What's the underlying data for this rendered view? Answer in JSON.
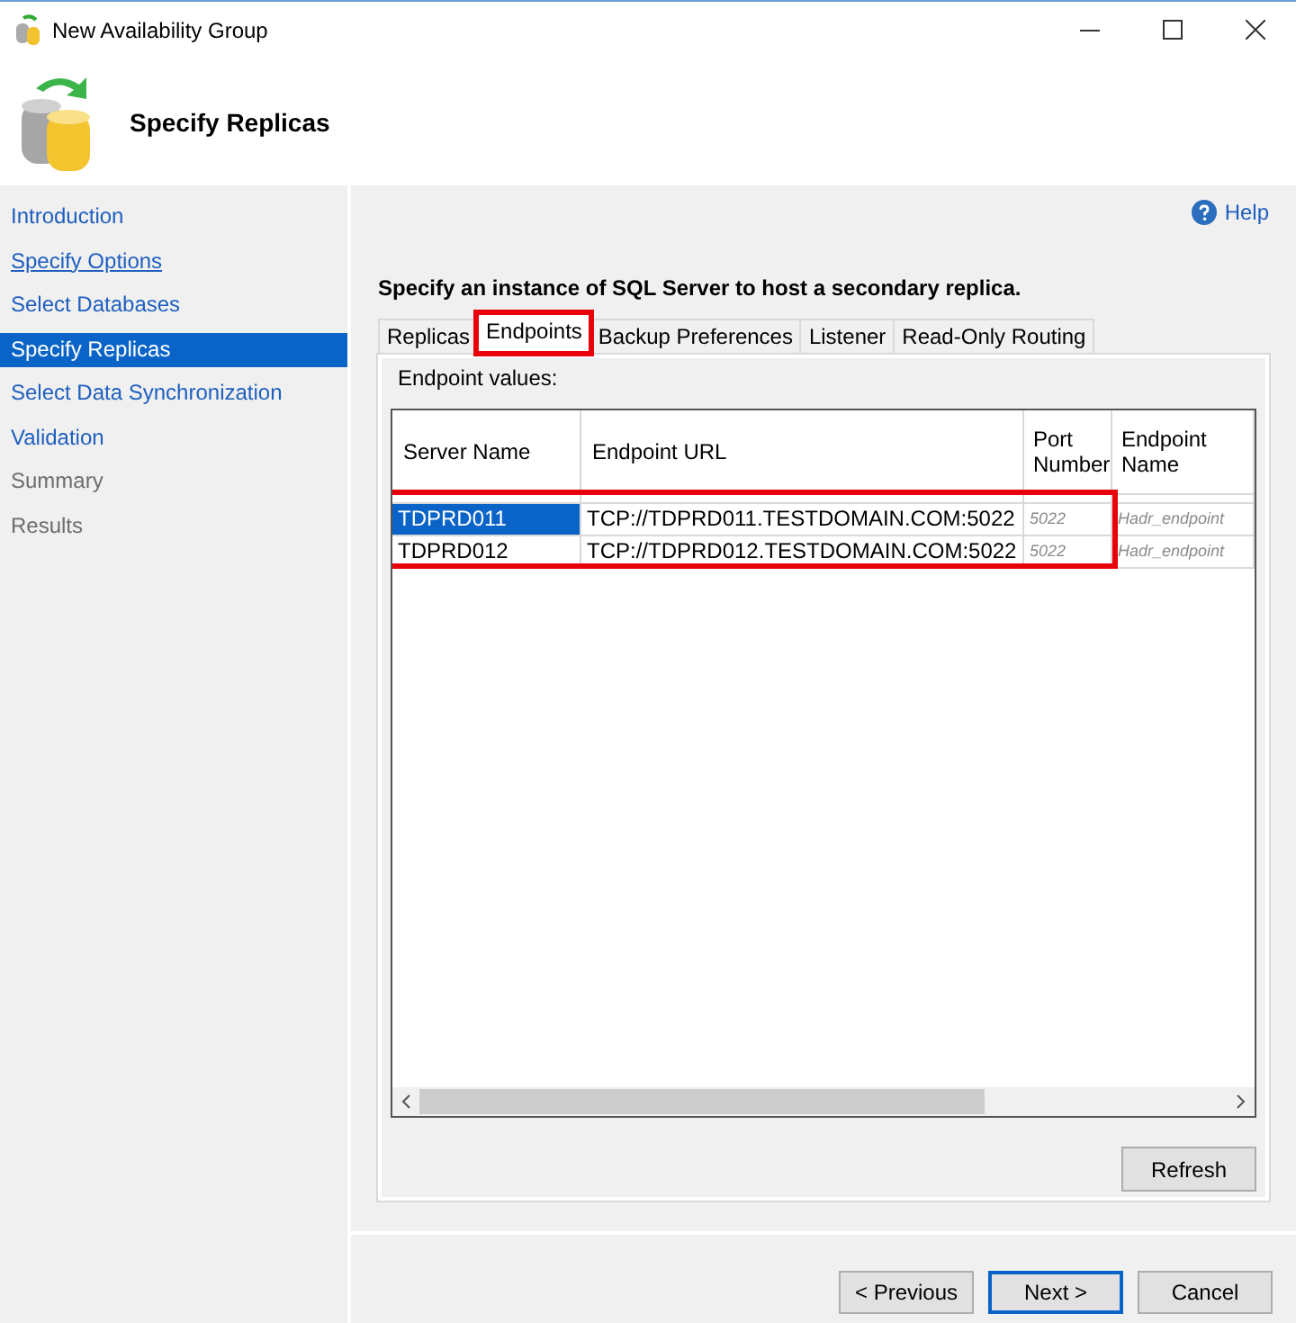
{
  "window": {
    "title": "New Availability Group"
  },
  "header": {
    "title": "Specify Replicas"
  },
  "sidebar": {
    "items": [
      {
        "label": "Introduction",
        "selected": false,
        "disabled": false,
        "visited": false
      },
      {
        "label": "Specify Options",
        "selected": false,
        "disabled": false,
        "visited": true
      },
      {
        "label": "Select Databases",
        "selected": false,
        "disabled": false,
        "visited": false
      },
      {
        "label": "Specify Replicas",
        "selected": true,
        "disabled": false,
        "visited": false
      },
      {
        "label": "Select Data Synchronization",
        "selected": false,
        "disabled": false,
        "visited": false
      },
      {
        "label": "Validation",
        "selected": false,
        "disabled": false,
        "visited": false
      },
      {
        "label": "Summary",
        "selected": false,
        "disabled": true,
        "visited": false
      },
      {
        "label": "Results",
        "selected": false,
        "disabled": true,
        "visited": false
      }
    ]
  },
  "help": "Help",
  "instruction": "Specify an instance of SQL Server to host a secondary replica.",
  "tabs": [
    {
      "label": "Replicas",
      "selected": false,
      "highlighted": false
    },
    {
      "label": "Endpoints",
      "selected": true,
      "highlighted": true
    },
    {
      "label": "Backup Preferences",
      "selected": false,
      "highlighted": false
    },
    {
      "label": "Listener",
      "selected": false,
      "highlighted": false
    },
    {
      "label": "Read-Only Routing",
      "selected": false,
      "highlighted": false
    }
  ],
  "panel_label": "Endpoint values:",
  "table": {
    "columns": [
      "Server Name",
      "Endpoint URL",
      "Port Number",
      "Endpoint Name"
    ],
    "rows_highlighted": true,
    "rows": [
      {
        "selected": true,
        "cells": [
          "TDPRD011",
          "TCP://TDPRD011.TESTDOMAIN.COM:5022",
          "5022",
          "Hadr_endpoint"
        ]
      },
      {
        "selected": false,
        "cells": [
          "TDPRD012",
          "TCP://TDPRD012.TESTDOMAIN.COM:5022",
          "5022",
          "Hadr_endpoint"
        ]
      }
    ]
  },
  "refresh_button": "Refresh",
  "buttons": [
    {
      "label": "< Previous",
      "default": false
    },
    {
      "label": "Next >",
      "default": true
    },
    {
      "label": "Cancel",
      "default": false
    }
  ]
}
